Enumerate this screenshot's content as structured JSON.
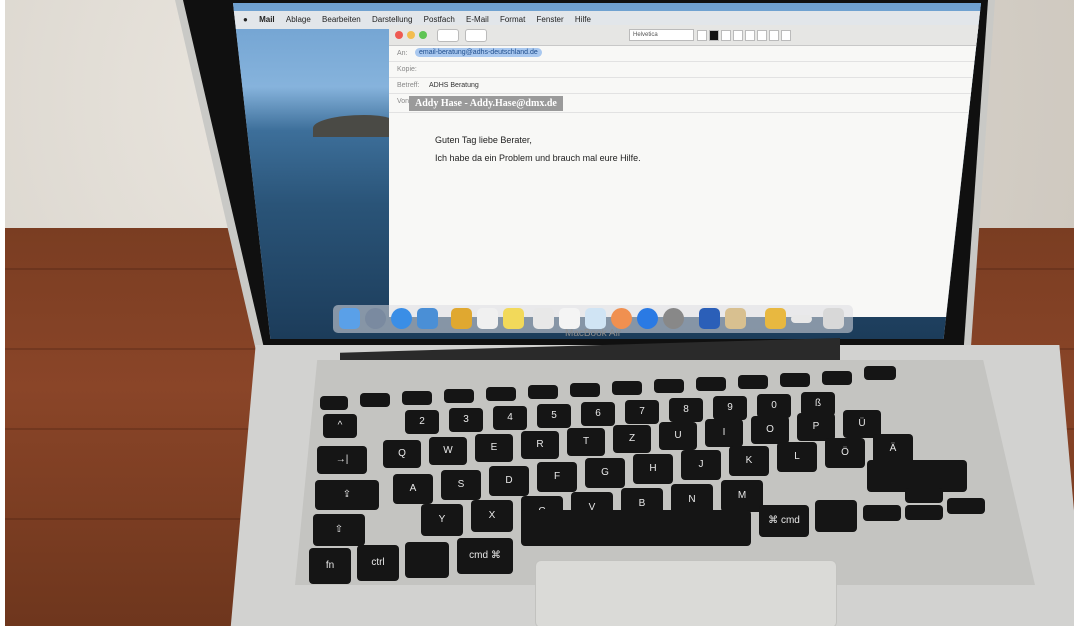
{
  "menubar": {
    "apple_icon": "apple-logo-icon",
    "items": [
      "Mail",
      "Ablage",
      "Bearbeiten",
      "Darstellung",
      "Postfach",
      "E-Mail",
      "Format",
      "Fenster",
      "Hilfe"
    ]
  },
  "mail": {
    "font_name": "Helvetica",
    "to_label": "An:",
    "to_value": "email-beratung@adhs-deutschland.de",
    "cc_label": "Kopie:",
    "subject_label": "Betreff:",
    "subject_value": "ADHS Beratung",
    "from_label": "Von:",
    "from_value": "Addy Hase - Addy.Hase@dmx.de",
    "body_lines": [
      "Guten Tag liebe Berater,",
      "Ich habe da ein Problem und brauch mal eure Hilfe."
    ]
  },
  "device_brand": "MacBook Air",
  "keyboard": {
    "row1": [
      "^",
      "2",
      "3",
      "4",
      "5",
      "6",
      "7",
      "8",
      "9",
      "0",
      "ß"
    ],
    "row2": [
      "Q",
      "W",
      "E",
      "R",
      "T",
      "Z",
      "U",
      "I",
      "O",
      "P",
      "Ü"
    ],
    "row3": [
      "A",
      "S",
      "D",
      "F",
      "G",
      "H",
      "J",
      "K",
      "L",
      "Ö",
      "Ä"
    ],
    "row4": [
      "Y",
      "X",
      "C",
      "V",
      "B",
      "N",
      "M"
    ],
    "fn": "fn",
    "ctrl": "ctrl",
    "cmd": "cmd",
    "cmd_symbol": "⌘",
    "cmd_right": "cmd",
    "tab": "→|",
    "shift": "⇧",
    "caps": "⇪"
  },
  "colors": {
    "to_chip": "#a9c8ef",
    "table_wood": "#7a3d22"
  }
}
